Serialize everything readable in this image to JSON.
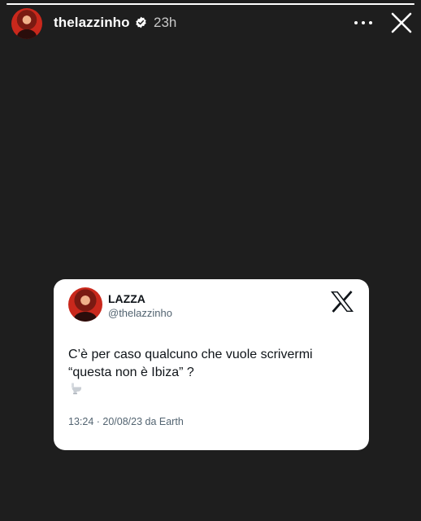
{
  "story": {
    "progress": 1.0,
    "header": {
      "username": "thelazzinho",
      "time_ago": "23h",
      "verified_icon": "verified-badge-icon",
      "more_icon": "more-horizontal-icon",
      "close_icon": "close-icon"
    }
  },
  "tweet_card": {
    "name": "LAZZA",
    "handle": "@thelazzinho",
    "logo_icon": "x-logo-icon",
    "text_line1": "C’è per caso qualcuno che vuole scrivermi",
    "text_line2": "“questa non è Ibiza” ?",
    "emoji_icon": "toilet-icon",
    "meta": "13:24 · 20/08/23 da Earth"
  },
  "colors": {
    "background": "#1e1e1e",
    "card": "#ffffff",
    "text_primary": "#0f1419",
    "text_secondary": "#536471"
  }
}
